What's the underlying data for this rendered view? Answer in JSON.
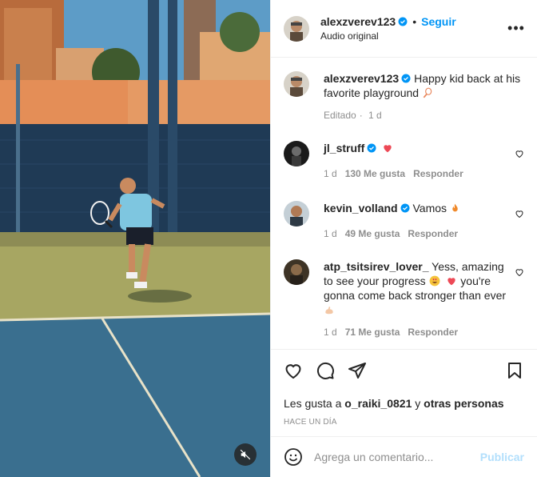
{
  "header": {
    "username": "alexzverev123",
    "follow_label": "Seguir",
    "audio_label": "Audio original",
    "more_label": "•••"
  },
  "caption": {
    "username": "alexzverev123",
    "text": "Happy kid back at his favorite playground",
    "edited": "Editado",
    "time": "1 d"
  },
  "comments": [
    {
      "username": "jl_struff",
      "text": "",
      "time": "1 d",
      "likes": "130 Me gusta",
      "reply": "Responder"
    },
    {
      "username": "kevin_volland",
      "text": "Vamos",
      "time": "1 d",
      "likes": "49 Me gusta",
      "reply": "Responder"
    },
    {
      "username": "atp_tsitsirev_lover_",
      "text": "Yess, amazing to see your progress",
      "text2": "you're gonna come back stronger than ever",
      "time": "1 d",
      "likes": "71 Me gusta",
      "reply": "Responder"
    }
  ],
  "likes": {
    "prefix": "Les gusta a",
    "user": "o_raiki_0821",
    "middle": "y",
    "others": "otras personas"
  },
  "posted": "HACE UN DÍA",
  "add_comment": {
    "placeholder": "Agrega un comentario...",
    "post_label": "Publicar"
  },
  "colors": {
    "accent": "#0095f6",
    "verified": "#0095f6",
    "heart": "#ed4956"
  }
}
